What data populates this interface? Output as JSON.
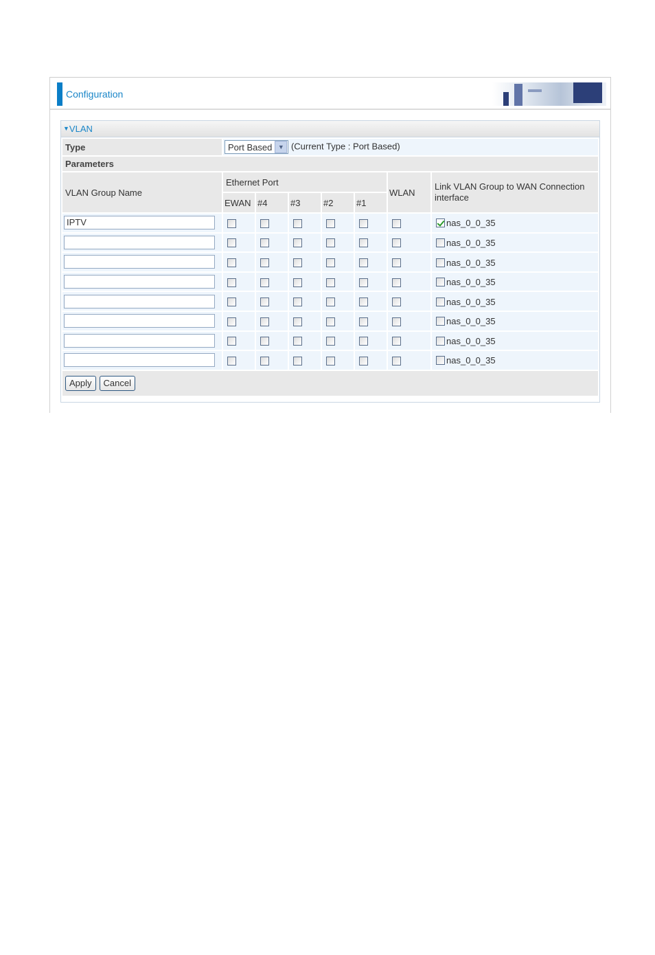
{
  "header": {
    "title": "Configuration"
  },
  "section": {
    "title": "VLAN",
    "icon": "triangle-down-icon"
  },
  "type_row": {
    "label": "Type",
    "select_value": "Port Based",
    "current_type": "(Current Type : Port Based)"
  },
  "parameters_label": "Parameters",
  "columns": {
    "group_name": "VLAN Group Name",
    "ethernet_port": "Ethernet Port",
    "ports": [
      "EWAN",
      "#4",
      "#3",
      "#2",
      "#1"
    ],
    "wlan": "WLAN",
    "link": "Link VLAN Group to WAN Connection interface"
  },
  "rows": [
    {
      "name": "IPTV",
      "ports": [
        false,
        false,
        false,
        false,
        false
      ],
      "wlan": false,
      "link_checked": true,
      "link_label": "nas_0_0_35"
    },
    {
      "name": "",
      "ports": [
        false,
        false,
        false,
        false,
        false
      ],
      "wlan": false,
      "link_checked": false,
      "link_label": "nas_0_0_35"
    },
    {
      "name": "",
      "ports": [
        false,
        false,
        false,
        false,
        false
      ],
      "wlan": false,
      "link_checked": false,
      "link_label": "nas_0_0_35"
    },
    {
      "name": "",
      "ports": [
        false,
        false,
        false,
        false,
        false
      ],
      "wlan": false,
      "link_checked": false,
      "link_label": "nas_0_0_35"
    },
    {
      "name": "",
      "ports": [
        false,
        false,
        false,
        false,
        false
      ],
      "wlan": false,
      "link_checked": false,
      "link_label": "nas_0_0_35"
    },
    {
      "name": "",
      "ports": [
        false,
        false,
        false,
        false,
        false
      ],
      "wlan": false,
      "link_checked": false,
      "link_label": "nas_0_0_35"
    },
    {
      "name": "",
      "ports": [
        false,
        false,
        false,
        false,
        false
      ],
      "wlan": false,
      "link_checked": false,
      "link_label": "nas_0_0_35"
    },
    {
      "name": "",
      "ports": [
        false,
        false,
        false,
        false,
        false
      ],
      "wlan": false,
      "link_checked": false,
      "link_label": "nas_0_0_35"
    }
  ],
  "buttons": {
    "apply": "Apply",
    "cancel": "Cancel"
  },
  "colors": {
    "accent": "#0a7ec7",
    "title": "#1a86c8"
  }
}
